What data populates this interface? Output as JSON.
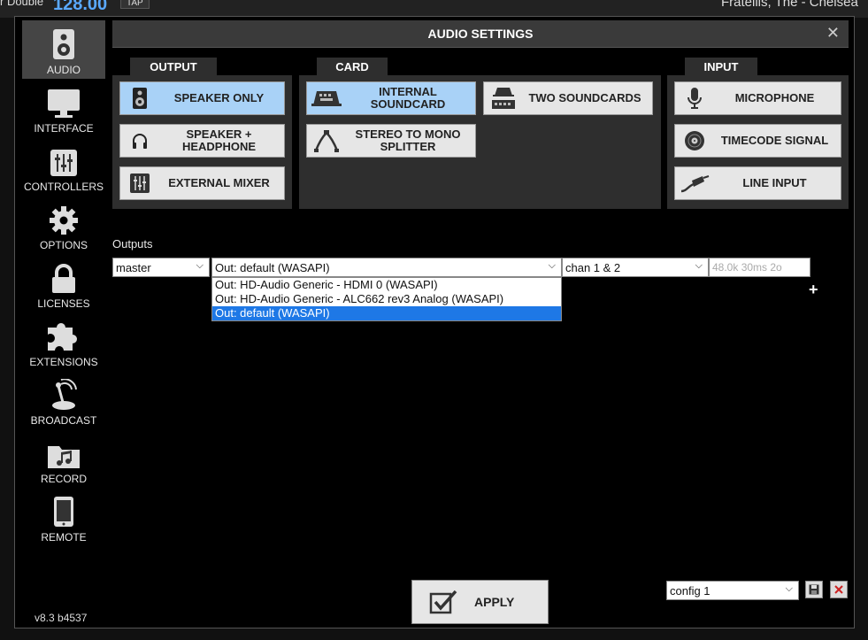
{
  "background": {
    "left_text": "r Double",
    "bpm": "128.00",
    "tap": "TAP",
    "song": "Fratellis, The - Chelsea"
  },
  "sidebar": {
    "items": [
      {
        "label": "AUDIO",
        "icon": "speaker-icon",
        "active": true
      },
      {
        "label": "INTERFACE",
        "icon": "monitor-icon"
      },
      {
        "label": "CONTROLLERS",
        "icon": "sliders-icon"
      },
      {
        "label": "OPTIONS",
        "icon": "gear-icon"
      },
      {
        "label": "LICENSES",
        "icon": "lock-icon"
      },
      {
        "label": "EXTENSIONS",
        "icon": "puzzle-icon"
      },
      {
        "label": "BROADCAST",
        "icon": "broadcast-icon"
      },
      {
        "label": "RECORD",
        "icon": "music-folder-icon"
      },
      {
        "label": "REMOTE",
        "icon": "phone-icon"
      }
    ],
    "version": "v8.3 b4537"
  },
  "window": {
    "title": "AUDIO SETTINGS",
    "close": "✕"
  },
  "output_group": {
    "title": "OUTPUT",
    "buttons": [
      {
        "label": "SPEAKER ONLY",
        "icon": "speaker-icon",
        "active": true
      },
      {
        "label": "SPEAKER + HEADPHONE",
        "icon": "headphone-icon"
      },
      {
        "label": "EXTERNAL MIXER",
        "icon": "mixer-icon"
      }
    ]
  },
  "card_group": {
    "title": "CARD",
    "buttons": [
      {
        "label": "INTERNAL SOUNDCARD",
        "icon": "internal-soundcard-icon",
        "active": true
      },
      {
        "label": "TWO SOUNDCARDS",
        "icon": "two-soundcards-icon"
      },
      {
        "label": "STEREO TO MONO SPLITTER",
        "icon": "splitter-cable-icon"
      }
    ]
  },
  "input_group": {
    "title": "INPUT",
    "buttons": [
      {
        "label": "MICROPHONE",
        "icon": "microphone-icon"
      },
      {
        "label": "TIMECODE SIGNAL",
        "icon": "vinyl-icon"
      },
      {
        "label": "LINE INPUT",
        "icon": "cable-icon"
      }
    ]
  },
  "outputs": {
    "label": "Outputs",
    "channel_select": "master",
    "device_select": "Out: default (WASAPI)",
    "chan_select": "chan 1 & 2",
    "info": "48.0k 30ms 2o",
    "dropdown_options": [
      "Out: HD-Audio Generic - HDMI 0 (WASAPI)",
      "Out: HD-Audio Generic - ALC662 rev3 Analog (WASAPI)",
      "Out: default (WASAPI)"
    ],
    "selected_index": 2,
    "add": "+"
  },
  "footer": {
    "apply": "APPLY",
    "config": "config 1"
  },
  "colors": {
    "active_button": "#a9d2f7",
    "selected_option": "#1e78e6",
    "panel": "#2e2e2e"
  }
}
